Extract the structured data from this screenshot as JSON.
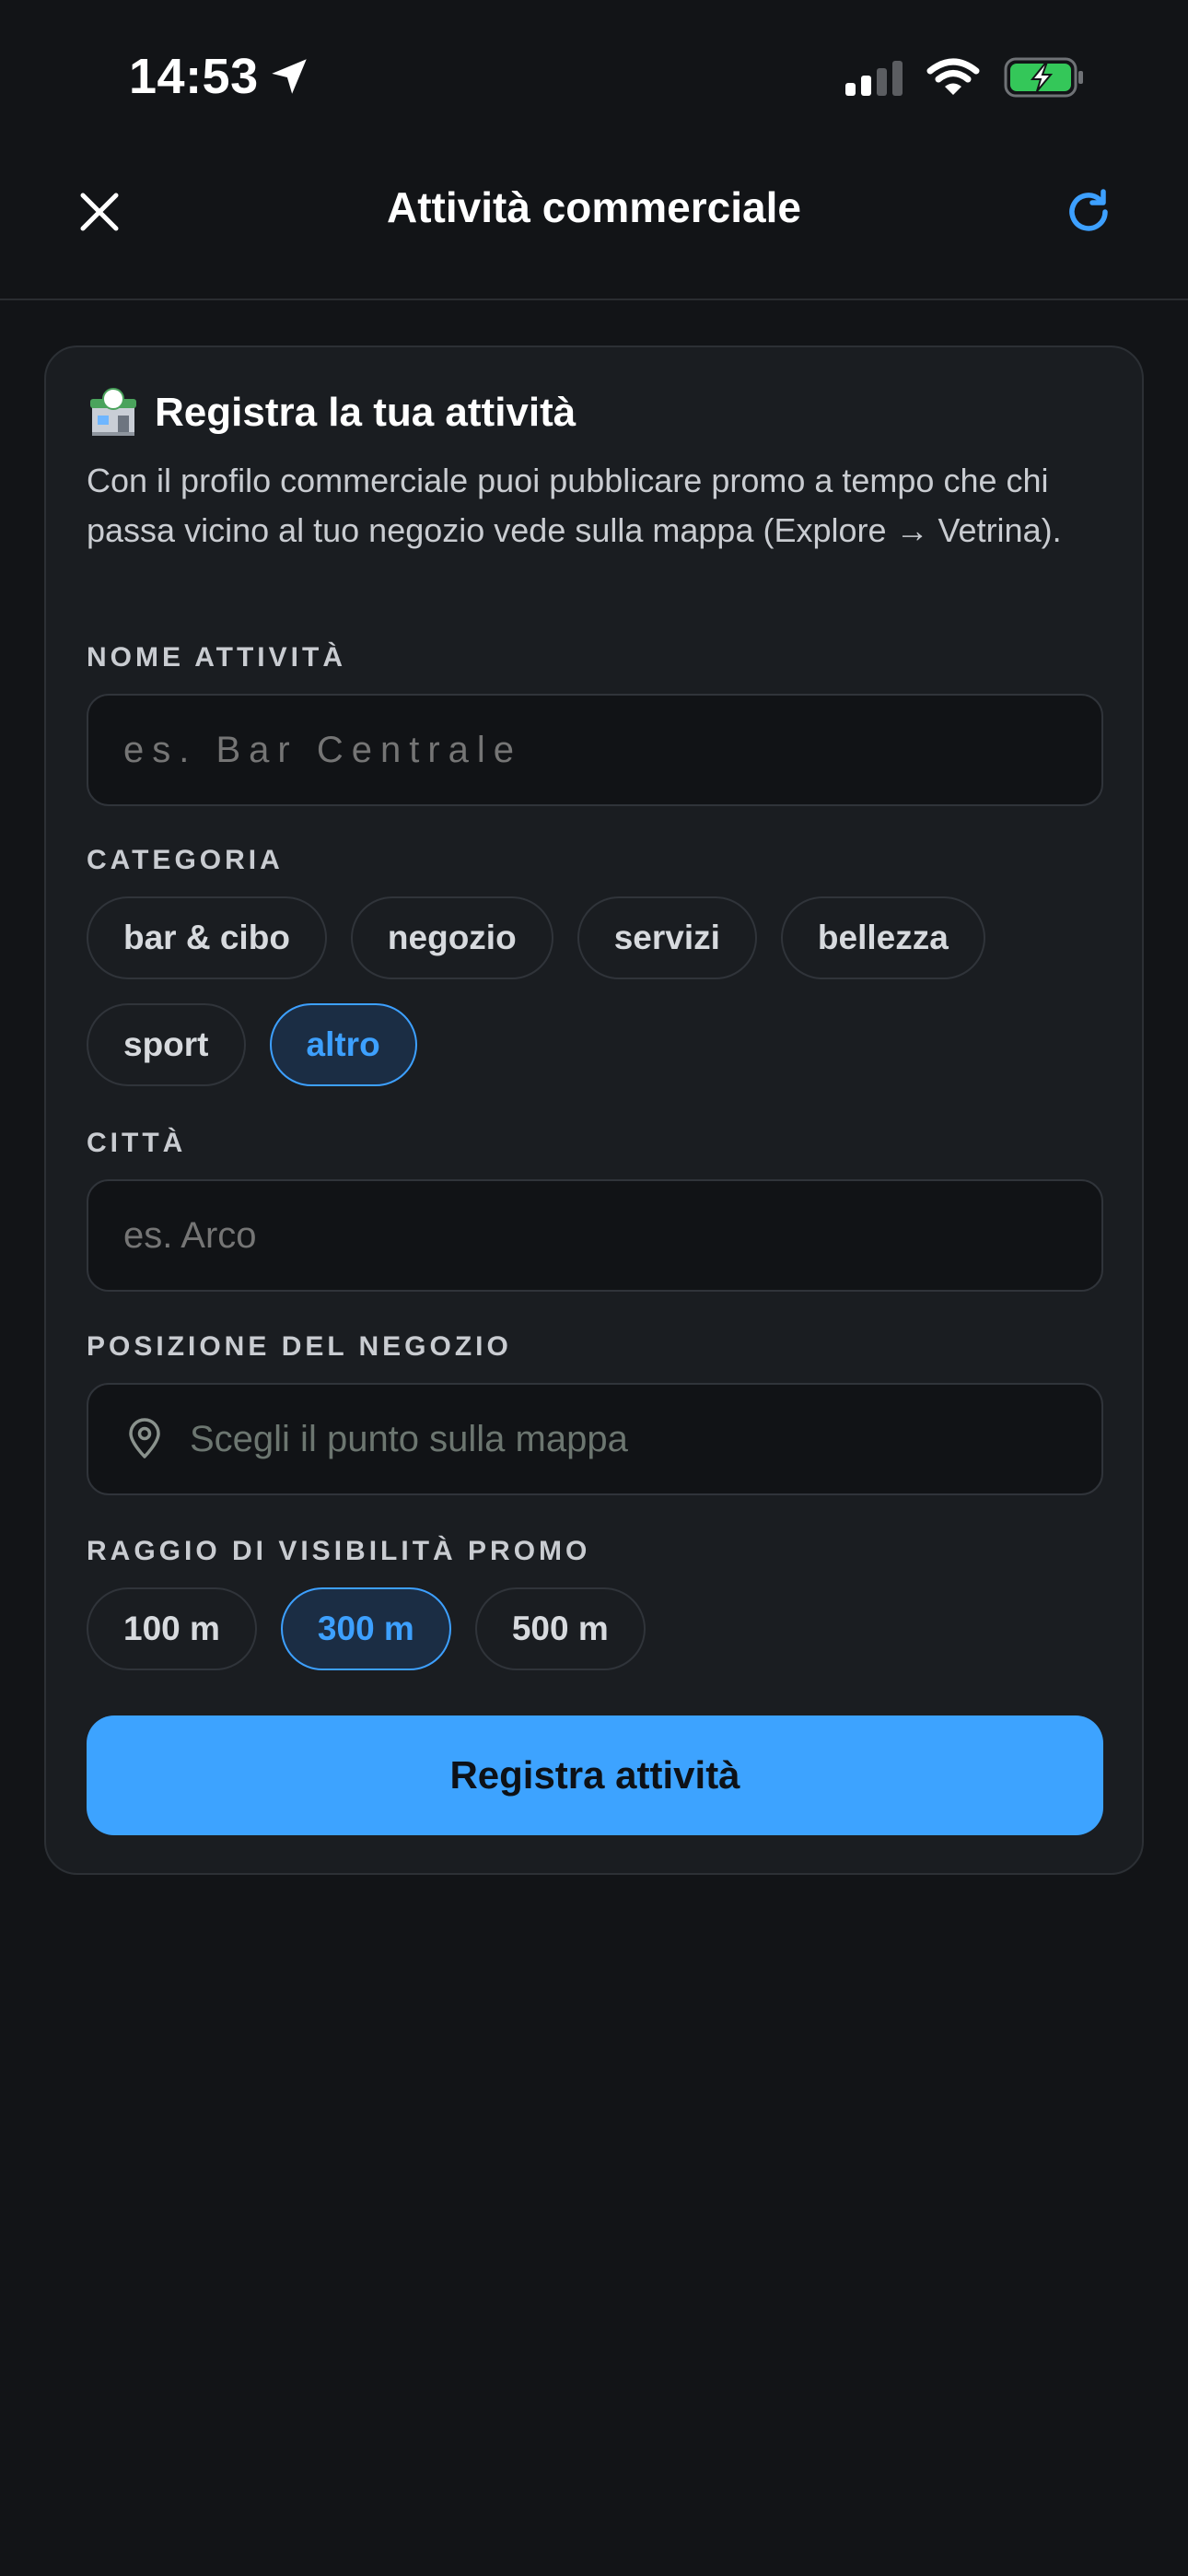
{
  "status_bar": {
    "time": "14:53",
    "location_icon": "location-arrow-icon",
    "signal_icon": "cellular-signal-icon",
    "wifi_icon": "wifi-icon",
    "battery_icon": "battery-charging-icon",
    "battery_color": "#34c759"
  },
  "header": {
    "close_icon": "close-icon",
    "title": "Attività commerciale",
    "refresh_icon": "refresh-icon",
    "accent_color": "#3da0ff"
  },
  "card": {
    "title_icon": "convenience-store-icon",
    "title": "Registra la tua attività",
    "description": "Con il profilo commerciale puoi pubblicare promo a tempo che chi passa vicino al tuo negozio vede sulla mappa (Explore → Vetrina)."
  },
  "form": {
    "business_name": {
      "label": "NOME ATTIVITÀ",
      "placeholder": "es. Bar Centrale",
      "value": ""
    },
    "category": {
      "label": "CATEGORIA",
      "options": [
        "bar & cibo",
        "negozio",
        "servizi",
        "bellezza",
        "sport",
        "altro"
      ],
      "selected": "altro"
    },
    "city": {
      "label": "CITTÀ",
      "placeholder": "es. Arco",
      "value": ""
    },
    "shop_location": {
      "label": "POSIZIONE DEL NEGOZIO",
      "icon": "map-pin-icon",
      "placeholder": "Scegli il punto sulla mappa"
    },
    "promo_radius": {
      "label": "RAGGIO DI VISIBILITÀ PROMO",
      "options": [
        "100 m",
        "300 m",
        "500 m"
      ],
      "selected": "300 m"
    },
    "submit_label": "Registra attività",
    "submit_color": "#3da3ff"
  }
}
